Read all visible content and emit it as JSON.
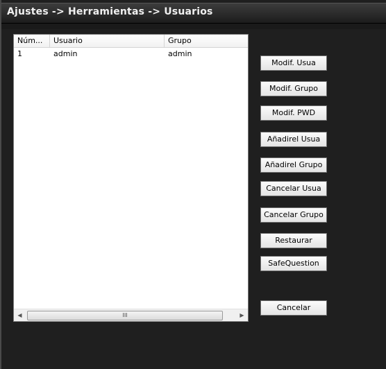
{
  "window": {
    "title": "Ajustes -> Herramientas -> Usuarios"
  },
  "table": {
    "columns": [
      "Núm...",
      "Usuario",
      "Grupo"
    ],
    "rows": [
      {
        "num": "1",
        "usuario": "admin",
        "grupo": "admin"
      }
    ],
    "scroll_thumb_grip": "III"
  },
  "buttons": {
    "modif_usua": "Modif. Usua",
    "modif_grupo": "Modif. Grupo",
    "modif_pwd": "Modif. PWD",
    "anadir_usua": "Añadirel Usua",
    "anadir_grupo": "Añadirel Grupo",
    "cancelar_usua": "Cancelar Usua",
    "cancelar_grupo": "Cancelar Grupo",
    "restaurar": "Restaurar",
    "safequestion": "SafeQuestion",
    "cancelar": "Cancelar"
  }
}
